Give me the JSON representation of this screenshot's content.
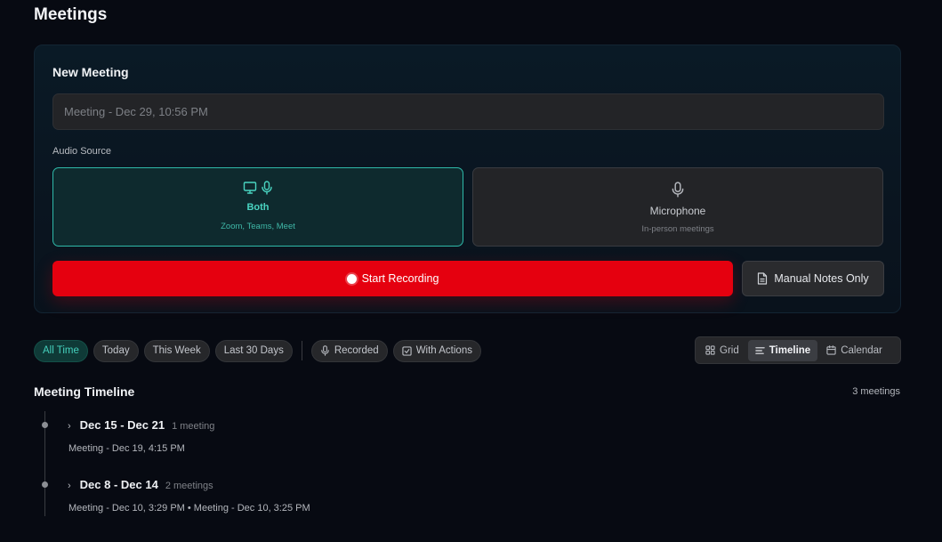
{
  "page": {
    "title": "Meetings"
  },
  "new_meeting": {
    "title": "New Meeting",
    "title_placeholder": "Meeting - Dec 29, 10:56 PM",
    "audio_source_label": "Audio Source",
    "sources": [
      {
        "name": "Both",
        "description": "Zoom, Teams, Meet",
        "selected": true,
        "icons": [
          "monitor-icon",
          "mic-icon"
        ]
      },
      {
        "name": "Microphone",
        "description": "In-person meetings",
        "selected": false,
        "icons": [
          "mic-icon"
        ]
      }
    ],
    "start_label": "Start Recording",
    "manual_label": "Manual Notes Only"
  },
  "filters": {
    "time": [
      "All Time",
      "Today",
      "This Week",
      "Last 30 Days"
    ],
    "active_time": "All Time",
    "recorded_label": "Recorded",
    "with_actions_label": "With Actions"
  },
  "views": {
    "items": [
      "Grid",
      "Timeline",
      "Calendar"
    ],
    "active": "Timeline"
  },
  "timeline": {
    "title": "Meeting Timeline",
    "count_label": "3 meetings",
    "weeks": [
      {
        "range": "Dec 15 - Dec 21",
        "count": "1 meeting",
        "meetings": "Meeting - Dec 19, 4:15 PM"
      },
      {
        "range": "Dec 8 - Dec 14",
        "count": "2 meetings",
        "meetings": "Meeting - Dec 10, 3:29 PM • Meeting - Dec 10, 3:25 PM"
      }
    ]
  },
  "colors": {
    "accent": "#2fb9a9",
    "record": "#e5000f",
    "background": "#070a12"
  }
}
